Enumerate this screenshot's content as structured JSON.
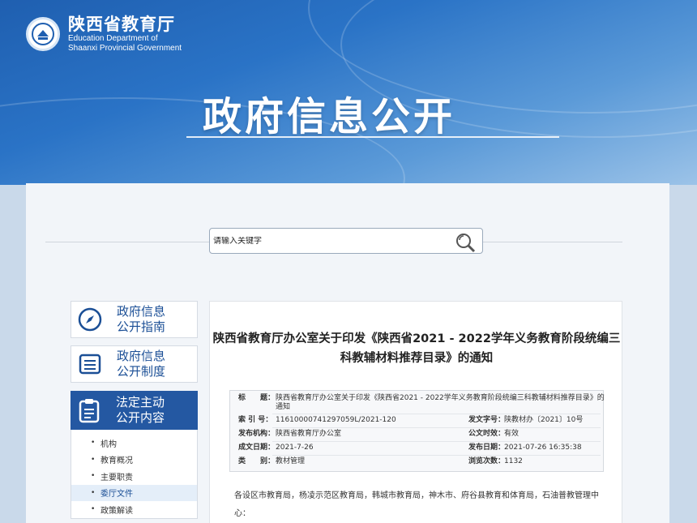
{
  "header": {
    "org_cn": "陕西省教育厅",
    "org_en_1": "Education Department of",
    "org_en_2": "Shaanxi Provincial Government",
    "banner_title": "政府信息公开"
  },
  "search": {
    "placeholder": "请输入关键字",
    "icon": "magnifier-icon"
  },
  "sidebar": {
    "guide": {
      "line1": "政府信息",
      "line2": "公开指南",
      "icon": "compass-icon"
    },
    "system": {
      "line1": "政府信息",
      "line2": "公开制度",
      "icon": "list-icon"
    },
    "active": {
      "line1": "法定主动",
      "line2": "公开内容",
      "icon": "clipboard-icon"
    },
    "items": [
      {
        "label": "机构"
      },
      {
        "label": "教育概况"
      },
      {
        "label": "主要职责"
      },
      {
        "label": "委厅文件"
      },
      {
        "label": "政策解读"
      }
    ]
  },
  "article": {
    "title_line1": "陕西省教育厅办公室关于印发《陕西省2021 - 2022学年义务教育阶段统编三",
    "title_line2": "科教辅材料推荐目录》的通知",
    "meta": {
      "title_label": "标　　题：",
      "title_value_1": "陕西省教育厅办公室关于印发《陕西省2021 - 2022学年义务教育阶段统编三科教辅材料推荐目录》的",
      "title_value_2": "通知",
      "index_label": "索 引 号：",
      "index_value": "11610000741297059L/2021-120",
      "doc_no_label": "发文字号：",
      "doc_no_value": "陕教材办〔2021〕10号",
      "issuer_label": "发布机构：",
      "issuer_value": "陕西省教育厅办公室",
      "validity_label": "公文时效：",
      "validity_value": "有效",
      "created_label": "成文日期：",
      "created_value": "2021-7-26",
      "published_label": "发布日期：",
      "published_value": "2021-07-26 16:35:38",
      "category_label": "类　　别：",
      "category_value": "教材管理",
      "views_label": "浏览次数：",
      "views_value": "1132"
    },
    "body_1": "各设区市教育局，杨凌示范区教育局，韩城市教育局，神木市、府谷县教育和体育局，石油普教管理中",
    "body_2": "心："
  }
}
